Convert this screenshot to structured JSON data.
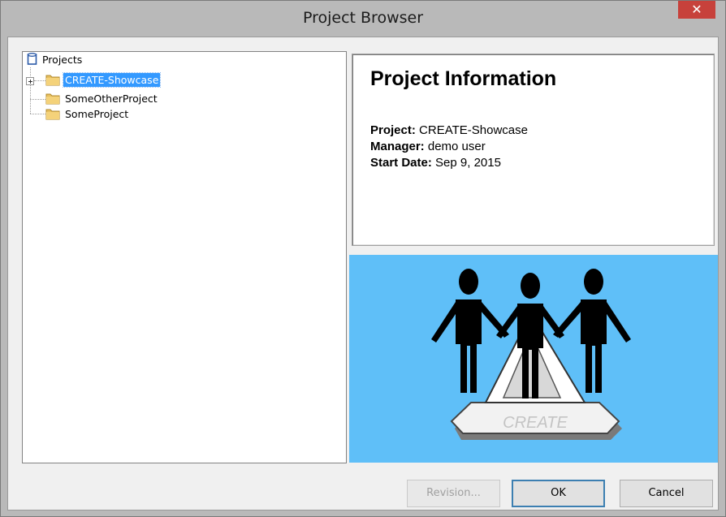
{
  "window": {
    "title": "Project Browser",
    "close_glyph": "✕"
  },
  "tree": {
    "root_label": "Projects",
    "root_icon": "database-icon",
    "items": [
      {
        "label": "CREATE-Showcase",
        "selected": true,
        "expandable": true,
        "icon": "folder-icon"
      },
      {
        "label": "SomeOtherProject",
        "selected": false,
        "expandable": false,
        "icon": "folder-icon"
      },
      {
        "label": "SomeProject",
        "selected": false,
        "expandable": false,
        "icon": "folder-icon"
      }
    ]
  },
  "info": {
    "heading": "Project Information",
    "project_label": "Project:",
    "project_value": "CREATE-Showcase",
    "manager_label": "Manager:",
    "manager_value": "demo user",
    "start_label": "Start Date:",
    "start_value": "Sep 9, 2015"
  },
  "logo": {
    "text": "CREATE",
    "background": "#5fbff8"
  },
  "buttons": {
    "revision": "Revision...",
    "ok": "OK",
    "cancel": "Cancel"
  },
  "colors": {
    "selection": "#3399ff",
    "close": "#c7413b",
    "titlebar": "#b9b9b9"
  }
}
